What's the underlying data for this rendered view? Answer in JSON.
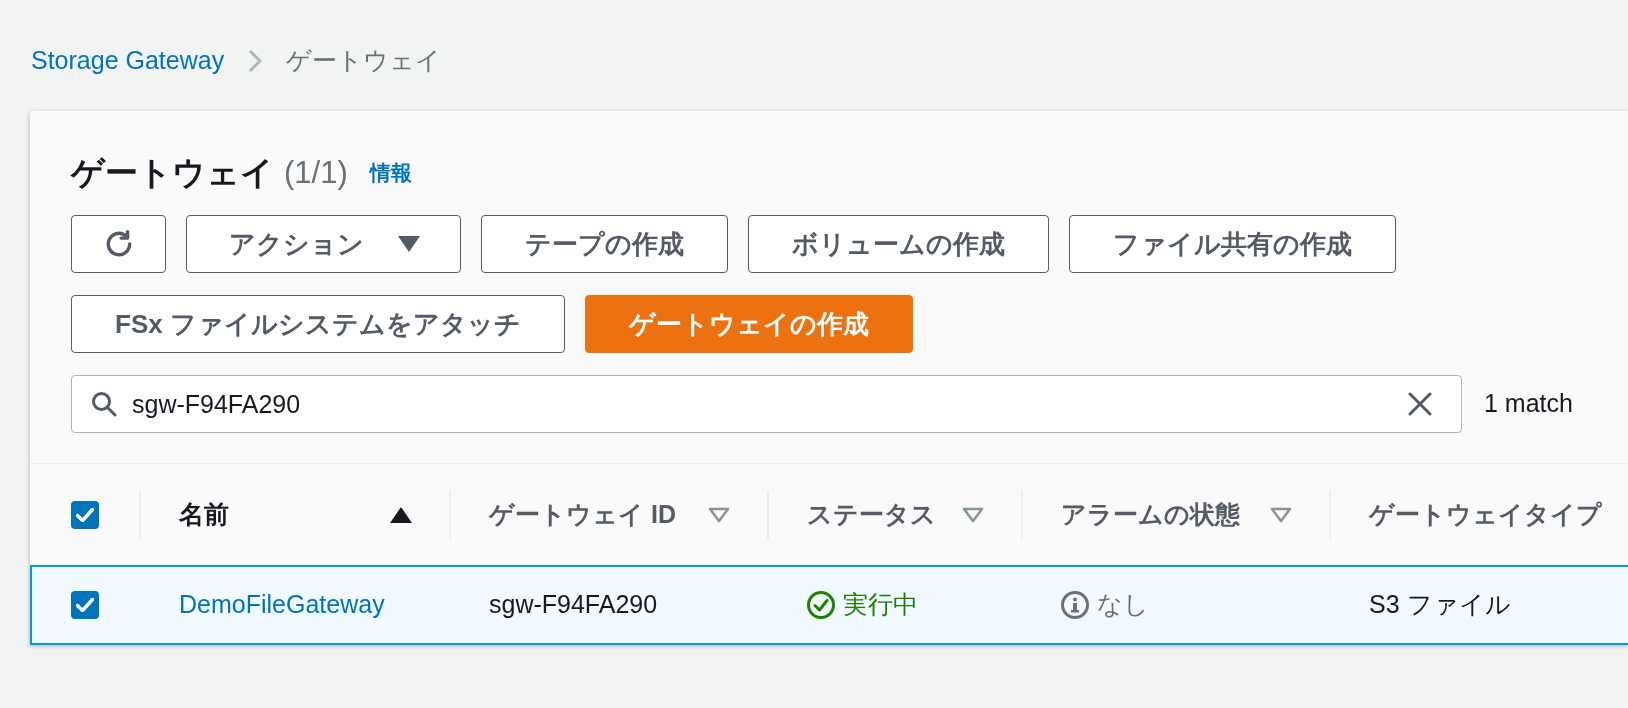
{
  "breadcrumb": [
    {
      "kind": "link",
      "label": "Storage Gateway"
    },
    {
      "kind": "current",
      "label": "ゲートウェイ"
    }
  ],
  "header": {
    "title": "ゲートウェイ",
    "counter": "(1/1)",
    "info_link": "情報"
  },
  "actions": [
    {
      "kind": "icon"
    },
    {
      "kind": "dropdown",
      "label": "アクション"
    },
    {
      "kind": "normal",
      "label": "テープの作成"
    },
    {
      "kind": "normal",
      "label": "ボリュームの作成"
    },
    {
      "kind": "normal",
      "label": "ファイル共有の作成"
    },
    {
      "kind": "normal",
      "label": "FSx ファイルシステムをアタッチ"
    },
    {
      "kind": "primary",
      "label": "ゲートウェイの作成"
    }
  ],
  "filter": {
    "value": "sgw-F94FA290",
    "match_count": "1 match"
  },
  "table": {
    "select_all": {
      "checked": true
    },
    "columns": [
      {
        "label": "名前",
        "sorted": true
      },
      {
        "label": "ゲートウェイ ID",
        "sorted": false
      },
      {
        "label": "ステータス",
        "sorted": false
      },
      {
        "label": "アラームの状態",
        "sorted": false
      },
      {
        "label": "ゲートウェイタイプ"
      }
    ],
    "rows": [
      {
        "selected": true,
        "name": "DemoFileGateway",
        "gateway_id": "sgw-F94FA290",
        "status": {
          "kind": "success",
          "label": "実行中"
        },
        "alarm_state": {
          "kind": "info",
          "label": "なし"
        },
        "gateway_type": "S3 ファイル"
      }
    ]
  }
}
